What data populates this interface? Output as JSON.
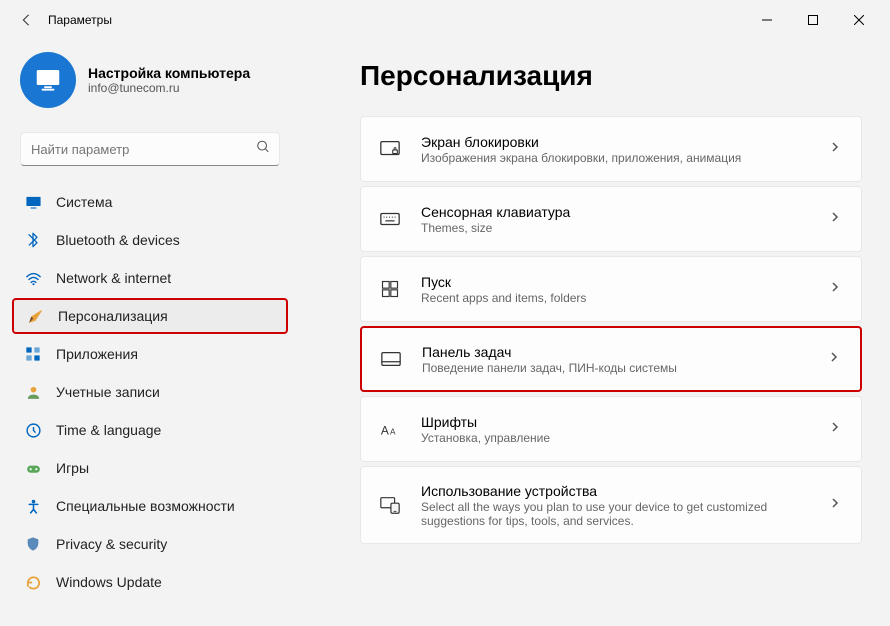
{
  "window": {
    "title": "Параметры"
  },
  "profile": {
    "name": "Настройка компьютера",
    "email": "info@tunecom.ru"
  },
  "search": {
    "placeholder": "Найти параметр"
  },
  "sidebar": {
    "items": [
      {
        "label": "Система"
      },
      {
        "label": "Bluetooth & devices"
      },
      {
        "label": "Network & internet"
      },
      {
        "label": "Персонализация"
      },
      {
        "label": "Приложения"
      },
      {
        "label": "Учетные записи"
      },
      {
        "label": "Time & language"
      },
      {
        "label": "Игры"
      },
      {
        "label": "Специальные возможности"
      },
      {
        "label": "Privacy & security"
      },
      {
        "label": "Windows Update"
      }
    ]
  },
  "main": {
    "title": "Персонализация",
    "items": [
      {
        "title": "Экран блокировки",
        "desc": "Изображения экрана блокировки, приложения, анимация"
      },
      {
        "title": "Сенсорная клавиатура",
        "desc": "Themes, size"
      },
      {
        "title": "Пуск",
        "desc": "Recent apps and items, folders"
      },
      {
        "title": "Панель задач",
        "desc": "Поведение панели задач, ПИН-коды системы"
      },
      {
        "title": "Шрифты",
        "desc": "Установка, управление"
      },
      {
        "title": "Использование устройства",
        "desc": "Select all the ways you plan to use your device to get customized suggestions for tips, tools, and services."
      }
    ]
  }
}
